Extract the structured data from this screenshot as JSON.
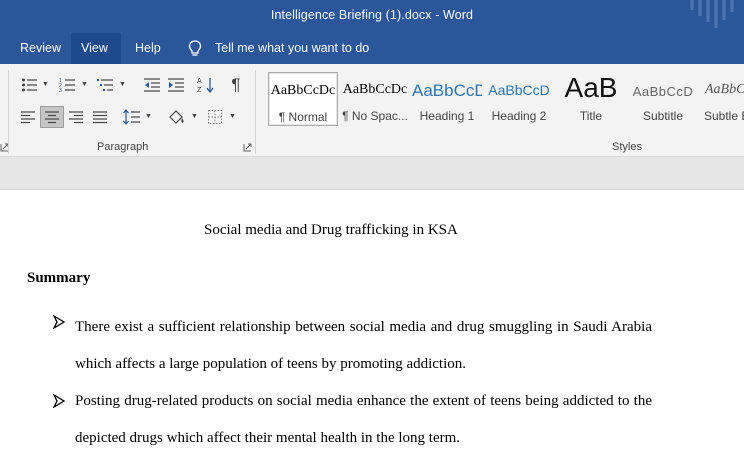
{
  "window": {
    "title": "Intelligence Briefing (1).docx  -  Word"
  },
  "menu": {
    "tabs": [
      {
        "label": "Review",
        "active": false
      },
      {
        "label": "View",
        "active": true
      },
      {
        "label": "Help",
        "active": false
      }
    ],
    "tell_me": "Tell me what you want to do"
  },
  "ribbon": {
    "paragraph_label": "Paragraph",
    "styles_label": "Styles",
    "styles": [
      {
        "sample": "AaBbCcDc",
        "label": "¶ Normal",
        "selected": true
      },
      {
        "sample": "AaBbCcDc",
        "label": "¶ No Spac...",
        "selected": false
      },
      {
        "sample": "AaBbCcD",
        "label": "Heading 1",
        "selected": false
      },
      {
        "sample": "AaBbCcD",
        "label": "Heading 2",
        "selected": false
      },
      {
        "sample": "AaB",
        "label": "Title",
        "selected": false
      },
      {
        "sample": "AaBbCcD",
        "label": "Subtitle",
        "selected": false
      },
      {
        "sample": "AaBbCcI",
        "label": "Subtle E",
        "selected": false
      }
    ]
  },
  "document": {
    "heading": "Social media and Drug trafficking in KSA",
    "summary": "Summary",
    "bullet_glyph": "➙",
    "bullets": [
      "There exist a sufficient relationship between social media and drug smuggling in Saudi Arabia which affects a large population of teens by promoting addiction.",
      "Posting drug-related products on social media enhance the extent of teens being addicted to the depicted drugs which affect their mental health in the long term."
    ]
  },
  "colors": {
    "title_bar": "#2b579a",
    "active_tab": "#1e4a8b",
    "ribbon_bg": "#f3f3f3",
    "heading_blue": "#2e74b5"
  },
  "icons": [
    "lightbulb-icon",
    "bullets-icon",
    "numbering-icon",
    "multilevel-list-icon",
    "decrease-indent-icon",
    "increase-indent-icon",
    "sort-icon",
    "pilcrow-icon",
    "align-left-icon",
    "align-center-icon",
    "align-right-icon",
    "justify-icon",
    "line-spacing-icon",
    "shading-icon",
    "borders-icon"
  ]
}
